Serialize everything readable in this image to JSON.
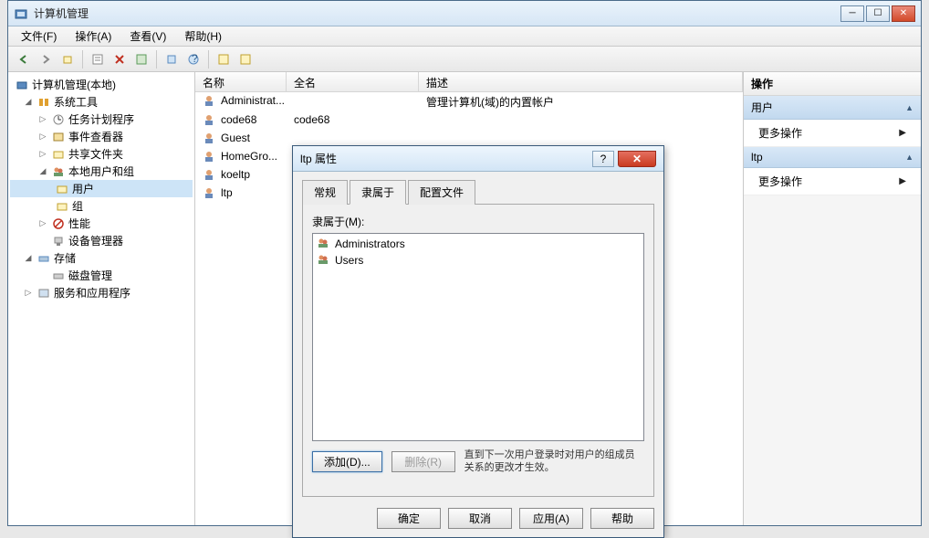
{
  "main_window": {
    "title": "计算机管理",
    "menus": {
      "file": "文件(F)",
      "action": "操作(A)",
      "view": "查看(V)",
      "help": "帮助(H)"
    }
  },
  "tree": {
    "root": "计算机管理(本地)",
    "sys_tools": "系统工具",
    "task_sched": "任务计划程序",
    "event_viewer": "事件查看器",
    "shared_folders": "共享文件夹",
    "local_users": "本地用户和组",
    "users": "用户",
    "groups": "组",
    "perf": "性能",
    "dev_mgr": "设备管理器",
    "storage": "存储",
    "disk_mgmt": "磁盘管理",
    "services": "服务和应用程序"
  },
  "list": {
    "col_name": "名称",
    "col_full": "全名",
    "col_desc": "描述",
    "rows": [
      {
        "name": "Administrat...",
        "full": "",
        "desc": "管理计算机(域)的内置帐户"
      },
      {
        "name": "code68",
        "full": "code68",
        "desc": ""
      },
      {
        "name": "Guest",
        "full": "",
        "desc": ""
      },
      {
        "name": "HomeGro...",
        "full": "",
        "desc": ""
      },
      {
        "name": "koeltp",
        "full": "",
        "desc": ""
      },
      {
        "name": "ltp",
        "full": "",
        "desc": ""
      }
    ]
  },
  "actions": {
    "header": "操作",
    "user_section": "用户",
    "more_ops": "更多操作",
    "ltp_section": "ltp"
  },
  "dialog": {
    "title": "ltp 属性",
    "tabs": {
      "general": "常规",
      "member": "隶属于",
      "profile": "配置文件"
    },
    "member_label": "隶属于(M):",
    "members": [
      "Administrators",
      "Users"
    ],
    "add": "添加(D)...",
    "remove": "删除(R)",
    "hint": "直到下一次用户登录时对用户的组成员关系的更改才生效。",
    "ok": "确定",
    "cancel": "取消",
    "apply": "应用(A)",
    "help": "帮助"
  }
}
